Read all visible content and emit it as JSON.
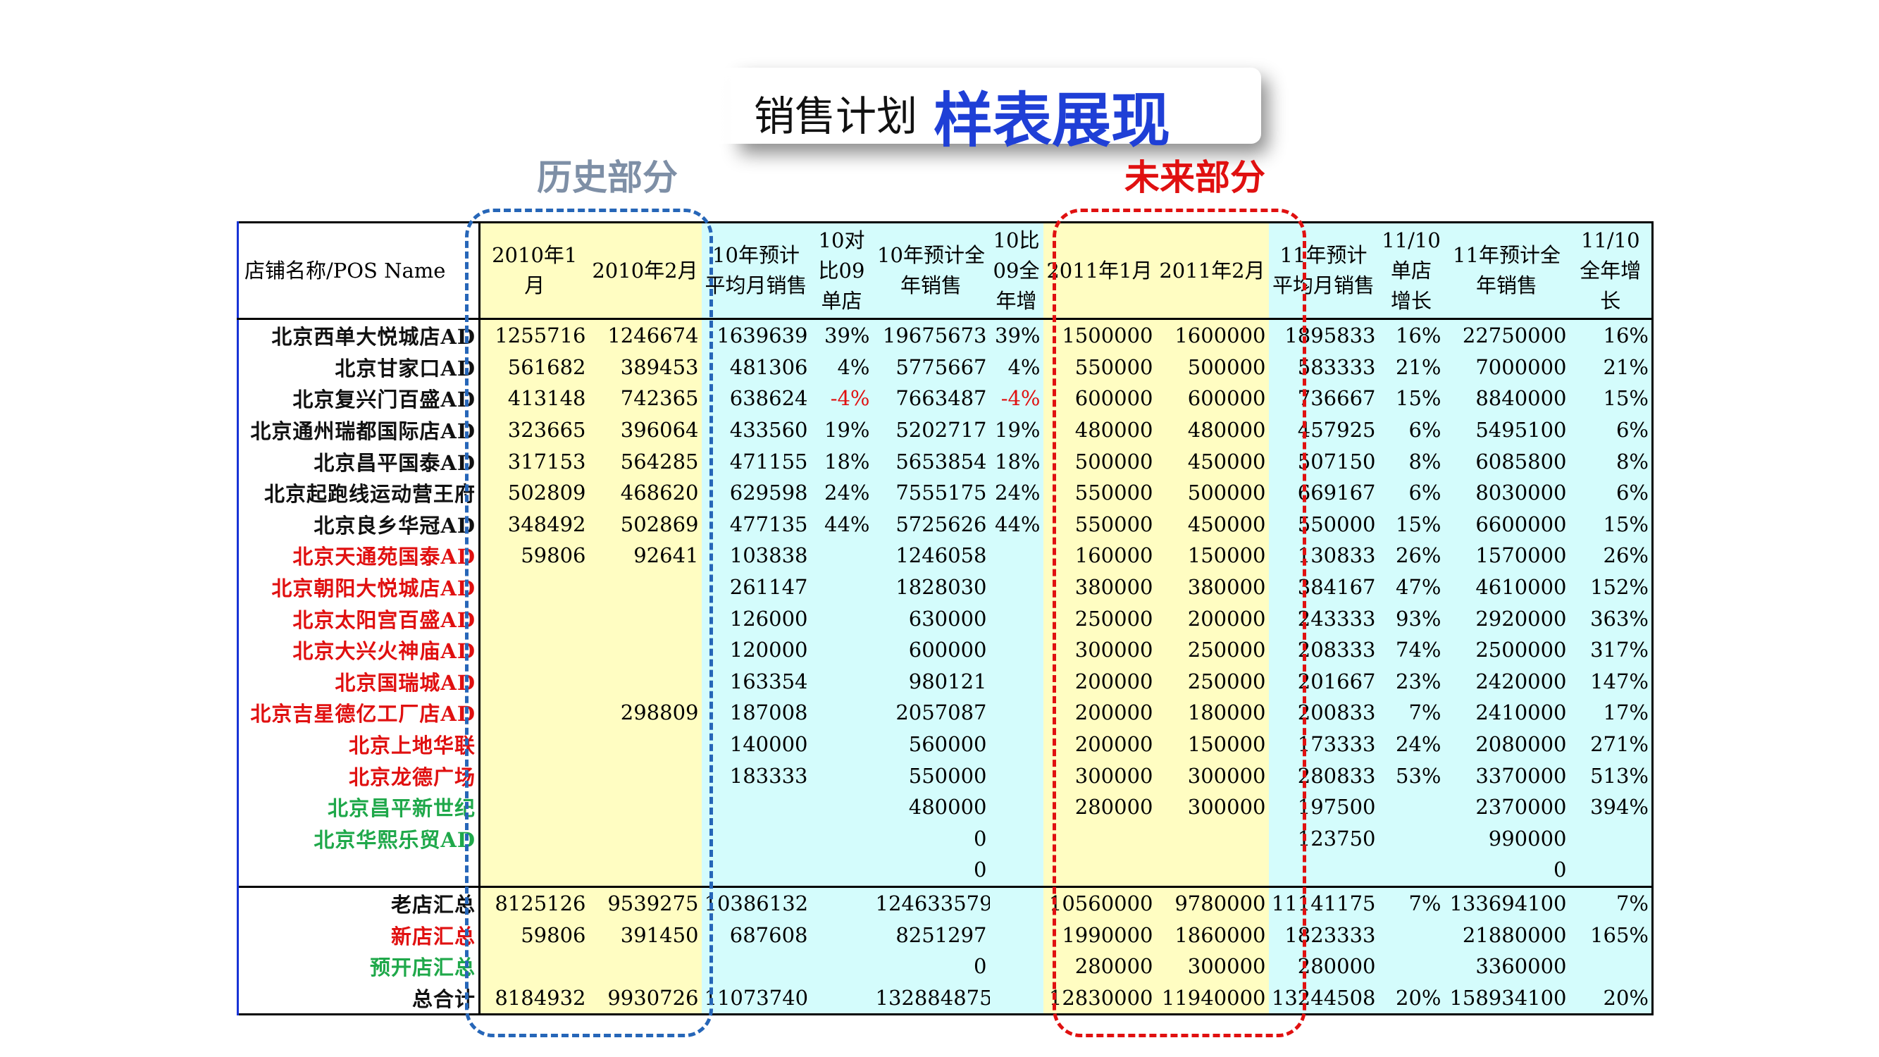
{
  "title": {
    "small": "销售计划",
    "big": "样表展现"
  },
  "labels": {
    "history": "历史部分",
    "future": "未来部分"
  },
  "headers": [
    "店铺名称/POS Name",
    "2010年1月",
    "2010年2月",
    "10年预计平均月销售",
    "10对比09单店",
    "10年预计全年销售",
    "10比09全年增",
    "2011年1月",
    "2011年2月",
    "11年预计平均月销售",
    "11/10单店增长",
    "11年预计全年销售",
    "11/10全年增长"
  ],
  "rows": [
    {
      "name": "北京西单大悦城店AD",
      "color": "black",
      "cells": [
        "1255716",
        "1246674",
        "1639639",
        "39%",
        "19675673",
        "39%",
        "1500000",
        "1600000",
        "1895833",
        "16%",
        "22750000",
        "16%"
      ]
    },
    {
      "name": "北京甘家口AD",
      "color": "black",
      "cells": [
        "561682",
        "389453",
        "481306",
        "4%",
        "5775667",
        "4%",
        "550000",
        "500000",
        "583333",
        "21%",
        "7000000",
        "21%"
      ]
    },
    {
      "name": "北京复兴门百盛AD",
      "color": "black",
      "cells": [
        "413148",
        "742365",
        "638624",
        "-4%",
        "7663487",
        "-4%",
        "600000",
        "600000",
        "736667",
        "15%",
        "8840000",
        "15%"
      ]
    },
    {
      "name": "北京通州瑞都国际店AD",
      "color": "black",
      "cells": [
        "323665",
        "396064",
        "433560",
        "19%",
        "5202717",
        "19%",
        "480000",
        "480000",
        "457925",
        "6%",
        "5495100",
        "6%"
      ]
    },
    {
      "name": "北京昌平国泰AD",
      "color": "black",
      "cells": [
        "317153",
        "564285",
        "471155",
        "18%",
        "5653854",
        "18%",
        "500000",
        "450000",
        "507150",
        "8%",
        "6085800",
        "8%"
      ]
    },
    {
      "name": "北京起跑线运动营王府",
      "color": "black",
      "cells": [
        "502809",
        "468620",
        "629598",
        "24%",
        "7555175",
        "24%",
        "550000",
        "500000",
        "669167",
        "6%",
        "8030000",
        "6%"
      ]
    },
    {
      "name": "北京良乡华冠AD",
      "color": "black",
      "cells": [
        "348492",
        "502869",
        "477135",
        "44%",
        "5725626",
        "44%",
        "550000",
        "450000",
        "550000",
        "15%",
        "6600000",
        "15%"
      ]
    },
    {
      "name": "北京天通苑国泰AD",
      "color": "red",
      "cells": [
        "59806",
        "92641",
        "103838",
        "",
        "1246058",
        "",
        "160000",
        "150000",
        "130833",
        "26%",
        "1570000",
        "26%"
      ]
    },
    {
      "name": "北京朝阳大悦城店AD",
      "color": "red",
      "cells": [
        "",
        "",
        "261147",
        "",
        "1828030",
        "",
        "380000",
        "380000",
        "384167",
        "47%",
        "4610000",
        "152%"
      ]
    },
    {
      "name": "北京太阳宫百盛AD",
      "color": "red",
      "cells": [
        "",
        "",
        "126000",
        "",
        "630000",
        "",
        "250000",
        "200000",
        "243333",
        "93%",
        "2920000",
        "363%"
      ]
    },
    {
      "name": "北京大兴火神庙AD",
      "color": "red",
      "cells": [
        "",
        "",
        "120000",
        "",
        "600000",
        "",
        "300000",
        "250000",
        "208333",
        "74%",
        "2500000",
        "317%"
      ]
    },
    {
      "name": "北京国瑞城AD",
      "color": "red",
      "cells": [
        "",
        "",
        "163354",
        "",
        "980121",
        "",
        "200000",
        "250000",
        "201667",
        "23%",
        "2420000",
        "147%"
      ]
    },
    {
      "name": "北京吉星德亿工厂店AD",
      "color": "red",
      "cells": [
        "",
        "298809",
        "187008",
        "",
        "2057087",
        "",
        "200000",
        "180000",
        "200833",
        "7%",
        "2410000",
        "17%"
      ]
    },
    {
      "name": "北京上地华联",
      "color": "red",
      "cells": [
        "",
        "",
        "140000",
        "",
        "560000",
        "",
        "200000",
        "150000",
        "173333",
        "24%",
        "2080000",
        "271%"
      ]
    },
    {
      "name": "北京龙德广场",
      "color": "red",
      "cells": [
        "",
        "",
        "183333",
        "",
        "550000",
        "",
        "300000",
        "300000",
        "280833",
        "53%",
        "3370000",
        "513%"
      ]
    },
    {
      "name": "北京昌平新世纪",
      "color": "green",
      "cells": [
        "",
        "",
        "",
        "",
        "480000",
        "",
        "280000",
        "300000",
        "197500",
        "",
        "2370000",
        "394%"
      ]
    },
    {
      "name": "北京华熙乐贸AD",
      "color": "green",
      "cells": [
        "",
        "",
        "",
        "",
        "0",
        "",
        "",
        "",
        "123750",
        "",
        "990000",
        ""
      ]
    },
    {
      "name": "",
      "color": "black",
      "cells": [
        "",
        "",
        "",
        "",
        "0",
        "",
        "",
        "",
        "",
        "",
        "0",
        ""
      ]
    }
  ],
  "summary": [
    {
      "name": "老店汇总",
      "color": "black",
      "cells": [
        "8125126",
        "9539275",
        "10386132",
        "",
        "124633579",
        "",
        "10560000",
        "9780000",
        "11141175",
        "7%",
        "133694100",
        "7%"
      ]
    },
    {
      "name": "新店汇总",
      "color": "red",
      "cells": [
        "59806",
        "391450",
        "687608",
        "",
        "8251297",
        "",
        "1990000",
        "1860000",
        "1823333",
        "",
        "21880000",
        "165%"
      ]
    },
    {
      "name": "预开店汇总",
      "color": "green",
      "cells": [
        "",
        "",
        "",
        "",
        "0",
        "",
        "280000",
        "300000",
        "280000",
        "",
        "3360000",
        ""
      ]
    },
    {
      "name": "总合计",
      "color": "black",
      "cells": [
        "8184932",
        "9930726",
        "11073740",
        "",
        "132884875",
        "",
        "12830000",
        "11940000",
        "13244508",
        "20%",
        "158934100",
        "20%"
      ]
    }
  ]
}
